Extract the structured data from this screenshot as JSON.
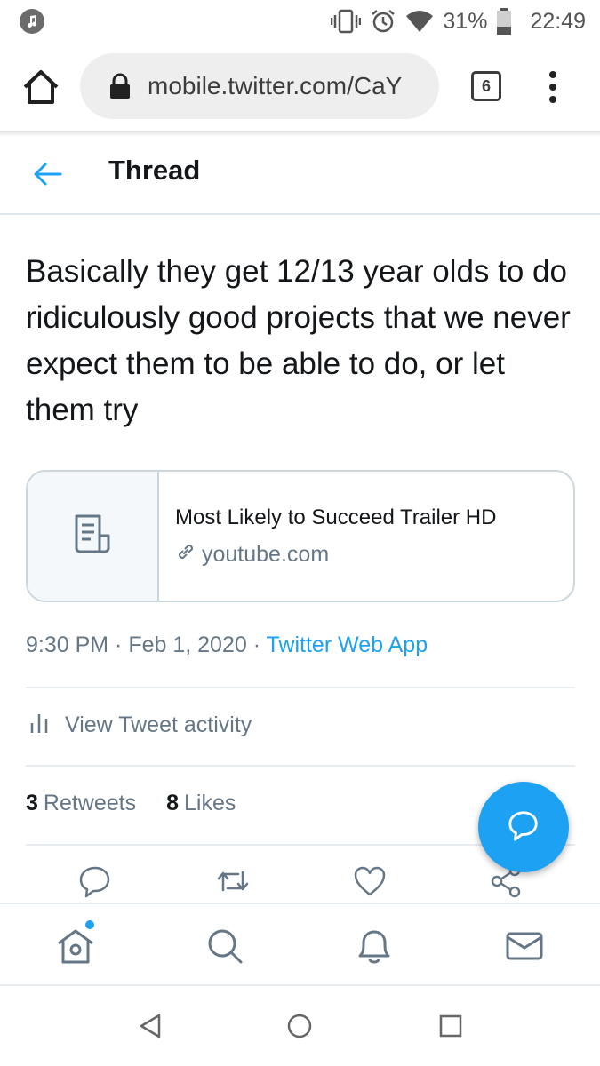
{
  "status_bar": {
    "battery": "31%",
    "time": "22:49",
    "icons": [
      "music-note-icon",
      "vibrate-icon",
      "alarm-icon",
      "wifi-icon",
      "battery-icon"
    ]
  },
  "browser": {
    "url": "mobile.twitter.com/CaY",
    "tab_count": "6",
    "icons": [
      "home-icon",
      "lock-icon",
      "more-vert-icon"
    ]
  },
  "header": {
    "title": "Thread",
    "back_icon": "arrow-left-icon"
  },
  "tweet": {
    "text": "Basically they get 12/13 year olds to do ridiculously good projects that we never expect them to be able to do, or let them try",
    "card": {
      "title": "Most Likely to Succeed Trailer HD",
      "domain": "youtube.com"
    },
    "time": "9:30 PM",
    "sep1": " · ",
    "date": "Feb 1, 2020",
    "sep2": " · ",
    "source": "Twitter Web App",
    "activity_label": "View Tweet activity",
    "retweets_count": "3",
    "retweets_label": "Retweets",
    "likes_count": "8",
    "likes_label": "Likes"
  },
  "colors": {
    "accent": "#1da1f2",
    "secondary_text": "#657786",
    "divider": "#e6ecf0"
  }
}
